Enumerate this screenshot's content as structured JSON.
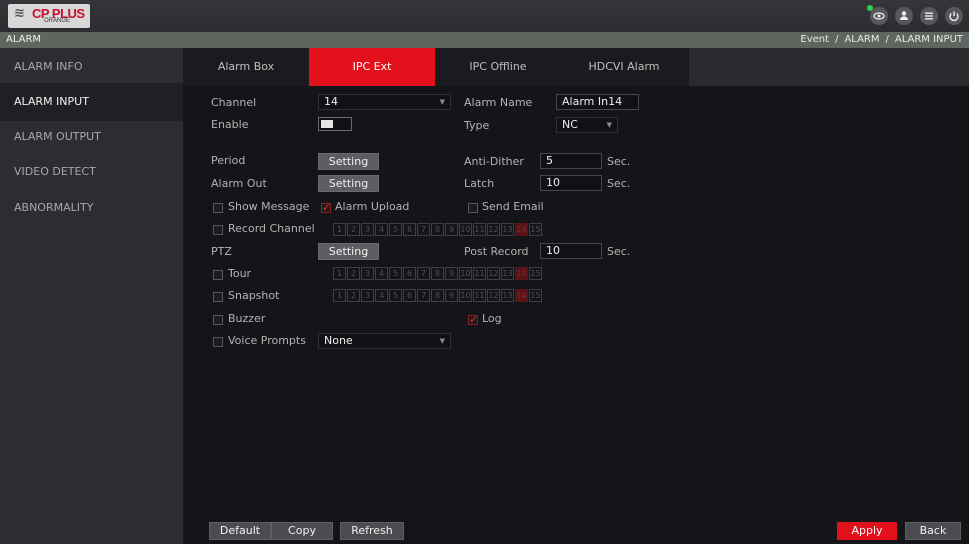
{
  "topbar": {
    "logo_mark": "≋",
    "logo_brand": "CP PLUS",
    "logo_sub": "ORANGE",
    "icons": [
      "eye-icon",
      "user-icon",
      "menu-icon",
      "power-icon"
    ]
  },
  "header": {
    "title": "ALARM",
    "breadcrumb": [
      "Event",
      "ALARM",
      "ALARM INPUT"
    ],
    "separator": "/"
  },
  "sidebar": {
    "items": [
      {
        "label": "ALARM INFO",
        "active": false
      },
      {
        "label": "ALARM INPUT",
        "active": true
      },
      {
        "label": "ALARM OUTPUT",
        "active": false
      },
      {
        "label": "VIDEO DETECT",
        "active": false
      },
      {
        "label": "ABNORMALITY",
        "active": false
      }
    ]
  },
  "tabs": [
    {
      "label": "Alarm Box",
      "active": false
    },
    {
      "label": "IPC Ext",
      "active": true
    },
    {
      "label": "IPC Offline",
      "active": false
    },
    {
      "label": "HDCVI Alarm",
      "active": false
    }
  ],
  "form": {
    "channel": {
      "label": "Channel",
      "value": "14"
    },
    "alarm_name": {
      "label": "Alarm Name",
      "value": "Alarm In14"
    },
    "enable": {
      "label": "Enable",
      "value": true
    },
    "type": {
      "label": "Type",
      "value": "NC"
    },
    "period": {
      "label": "Period",
      "button": "Setting"
    },
    "anti_dither": {
      "label": "Anti-Dither",
      "value": "5",
      "unit": "Sec."
    },
    "alarm_out": {
      "label": "Alarm Out",
      "button": "Setting"
    },
    "latch": {
      "label": "Latch",
      "value": "10",
      "unit": "Sec."
    },
    "show_message": {
      "label": "Show Message",
      "checked": false
    },
    "alarm_upload": {
      "label": "Alarm Upload",
      "checked": true
    },
    "send_email": {
      "label": "Send Email",
      "checked": false
    },
    "record_channel": {
      "label": "Record Channel",
      "checked": false
    },
    "ptz": {
      "label": "PTZ",
      "button": "Setting"
    },
    "post_record": {
      "label": "Post Record",
      "value": "10",
      "unit": "Sec."
    },
    "tour": {
      "label": "Tour",
      "checked": false
    },
    "snapshot": {
      "label": "Snapshot",
      "checked": false
    },
    "buzzer": {
      "label": "Buzzer",
      "checked": false
    },
    "log": {
      "label": "Log",
      "checked": true
    },
    "voice_prompts": {
      "label": "Voice Prompts",
      "checked": false,
      "value": "None"
    },
    "channels": [
      "1",
      "2",
      "3",
      "4",
      "5",
      "6",
      "7",
      "8",
      "9",
      "10",
      "11",
      "12",
      "13",
      "14",
      "15"
    ],
    "selected_channel": "14"
  },
  "footer": {
    "default": "Default",
    "copy": "Copy",
    "refresh": "Refresh",
    "apply": "Apply",
    "back": "Back"
  },
  "colors": {
    "accent": "#e2101b",
    "sidebar_active": "#1f2023",
    "status_green": "#2bd14a"
  }
}
